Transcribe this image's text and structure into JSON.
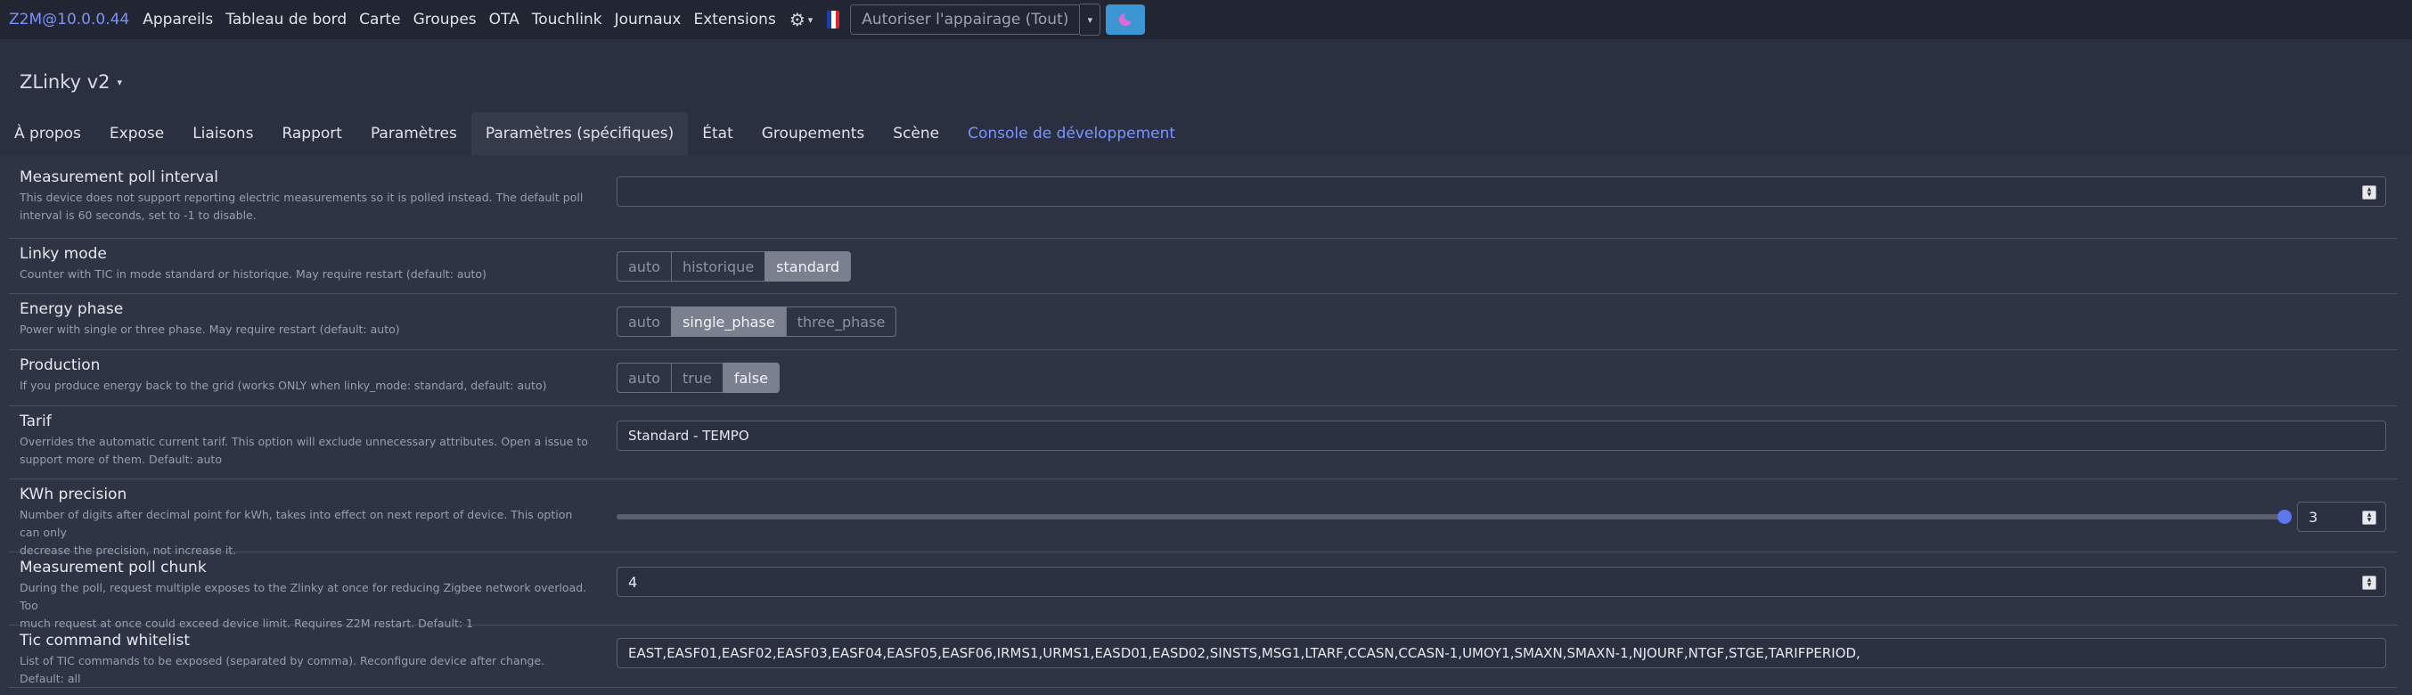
{
  "nav": {
    "brand": "Z2M@10.0.0.44",
    "links": [
      "Appareils",
      "Tableau de bord",
      "Carte",
      "Groupes",
      "OTA",
      "Touchlink",
      "Journaux",
      "Extensions"
    ],
    "permit_join": "Autoriser l'appairage (Tout)",
    "icons": {
      "settings": "gear-icon",
      "language": "flag-fr-icon",
      "theme": "moon-icon"
    },
    "flag_colors": [
      "#1f3fa8",
      "#ffffff",
      "#e1252c"
    ]
  },
  "device": {
    "name": "ZLinky v2"
  },
  "tabs": [
    {
      "label": "À propos"
    },
    {
      "label": "Expose"
    },
    {
      "label": "Liaisons"
    },
    {
      "label": "Rapport"
    },
    {
      "label": "Paramètres"
    },
    {
      "label": "Paramètres (spécifiques)",
      "active": true
    },
    {
      "label": "État"
    },
    {
      "label": "Groupements"
    },
    {
      "label": "Scène"
    },
    {
      "label": "Console de développement",
      "link": true
    }
  ],
  "settings": {
    "poll_interval": {
      "title": "Measurement poll interval",
      "desc1": "This device does not support reporting electric measurements so it is polled instead. The default poll",
      "desc2": "interval is 60 seconds, set to -1 to disable.",
      "value": ""
    },
    "linky_mode": {
      "title": "Linky mode",
      "desc1": "Counter with TIC in mode standard or historique. May require restart (default: auto)",
      "options": [
        "auto",
        "historique",
        "standard"
      ],
      "selected": "standard"
    },
    "energy_phase": {
      "title": "Energy phase",
      "desc1": "Power with single or three phase. May require restart (default: auto)",
      "options": [
        "auto",
        "single_phase",
        "three_phase"
      ],
      "selected": "single_phase"
    },
    "production": {
      "title": "Production",
      "desc1": "If you produce energy back to the grid (works ONLY when linky_mode: standard, default: auto)",
      "options": [
        "auto",
        "true",
        "false"
      ],
      "selected": "false"
    },
    "tarif": {
      "title": "Tarif",
      "desc1": "Overrides the automatic current tarif. This option will exclude unnecessary attributes. Open a issue to",
      "desc2": "support more of them. Default: auto",
      "value": "Standard - TEMPO"
    },
    "kwh_precision": {
      "title": "KWh precision",
      "desc1": "Number of digits after decimal point for kWh, takes into effect on next report of device. This option can only",
      "desc2": "decrease the precision, not increase it.",
      "value": "3",
      "slider_fraction": 1.0
    },
    "poll_chunk": {
      "title": "Measurement poll chunk",
      "desc1": "During the poll, request multiple exposes to the Zlinky at once for reducing Zigbee network overload. Too",
      "desc2": "much request at once could exceed device limit. Requires Z2M restart. Default: 1",
      "value": "4"
    },
    "tic_whitelist": {
      "title": "Tic command whitelist",
      "desc1": "List of TIC commands to be exposed (separated by comma). Reconfigure device after change. Default: all",
      "value": "EAST,EASF01,EASF02,EASF03,EASF04,EASF05,EASF06,IRMS1,URMS1,EASD01,EASD02,SINSTS,MSG1,LTARF,CCASN,CCASN-1,UMOY1,SMAXN,SMAXN-1,NJOURF,NTGF,STGE,TARIFPERIOD,"
    }
  }
}
